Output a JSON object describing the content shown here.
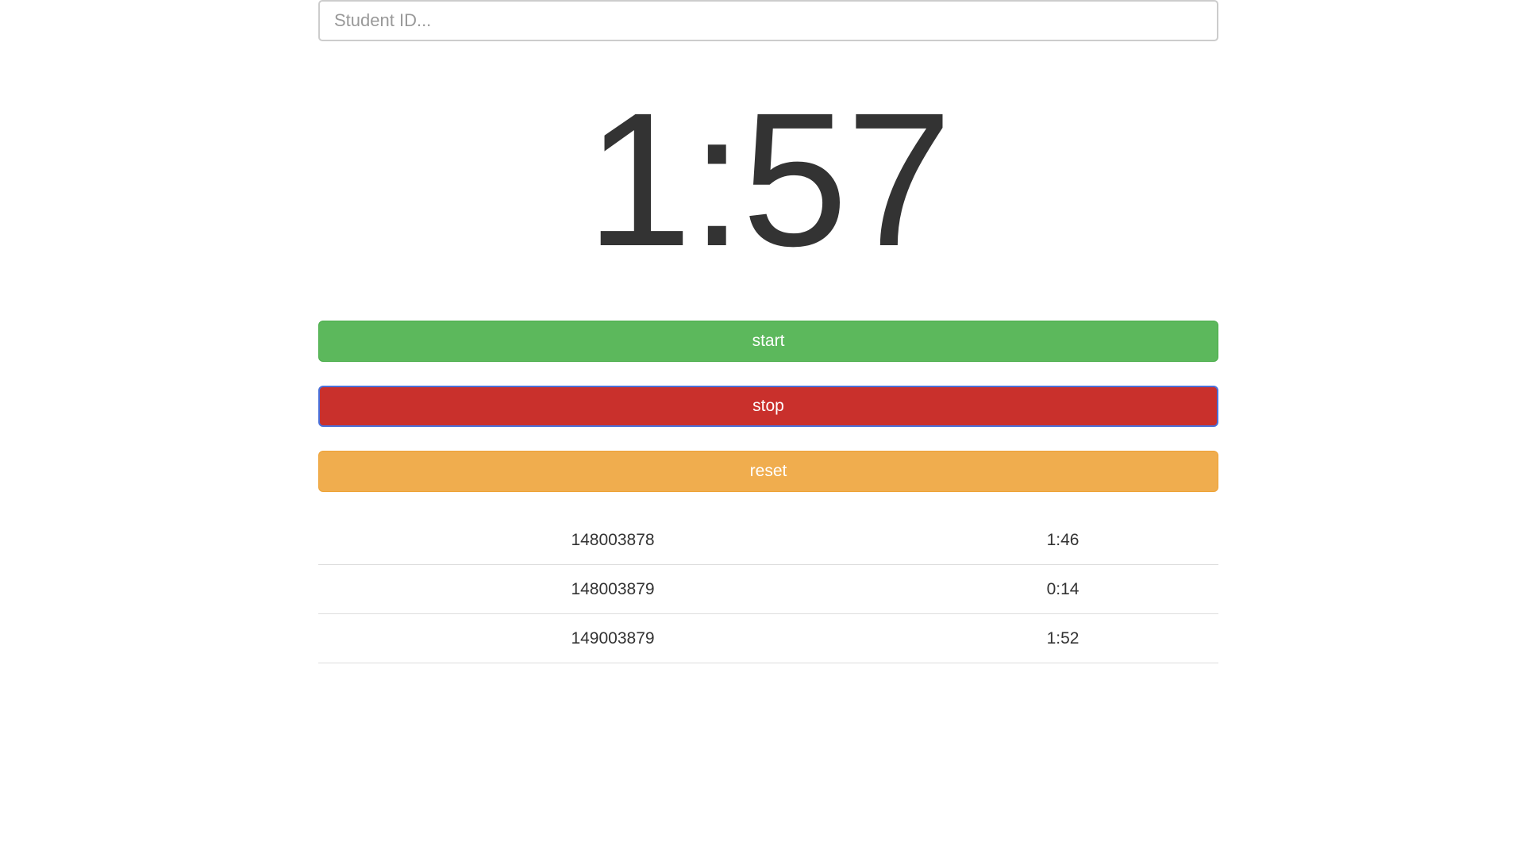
{
  "search": {
    "placeholder": "Student ID...",
    "value": ""
  },
  "timer": {
    "display": "1:57"
  },
  "buttons": {
    "start_label": "start",
    "stop_label": "stop",
    "reset_label": "reset"
  },
  "results": [
    {
      "student_id": "148003878",
      "time": "1:46"
    },
    {
      "student_id": "148003879",
      "time": "0:14"
    },
    {
      "student_id": "149003879",
      "time": "1:52"
    }
  ],
  "colors": {
    "start": "#5cb85c",
    "stop": "#c9302c",
    "reset": "#f0ad4e",
    "focus_ring": "#4a6fd8"
  }
}
